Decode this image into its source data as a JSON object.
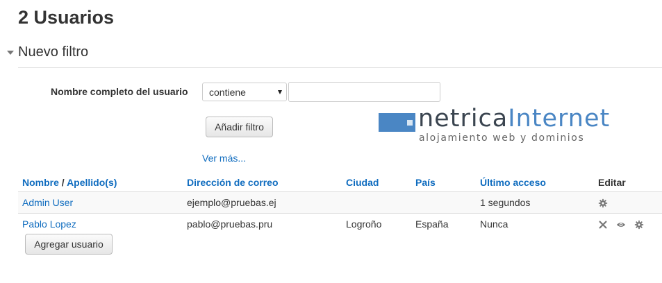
{
  "page": {
    "title": "2 Usuarios"
  },
  "filter": {
    "legend": "Nuevo filtro",
    "field_label": "Nombre completo del usuario",
    "operator": "contiene",
    "value": "",
    "add_button": "Añadir filtro",
    "more_link": "Ver más..."
  },
  "logo": {
    "word1": "netrica",
    "word2": "Internet",
    "tagline": "alojamiento web y dominios"
  },
  "table": {
    "headers": {
      "nombre": "Nombre",
      "separator": " / ",
      "apellidos": "Apellido(s)",
      "correo": "Dirección de correo",
      "ciudad": "Ciudad",
      "pais": "País",
      "acceso": "Último acceso",
      "editar": "Editar"
    },
    "rows": [
      {
        "name": "Admin User",
        "email": "ejemplo@pruebas.ej",
        "city": "",
        "country": "",
        "last_access": "1 segundos",
        "actions": [
          "gear-icon"
        ]
      },
      {
        "name": "Pablo Lopez",
        "email": "pablo@pruebas.pru",
        "city": "Logroño",
        "country": "España",
        "last_access": "Nunca",
        "actions": [
          "delete-icon",
          "eye-icon",
          "gear-icon"
        ]
      }
    ]
  },
  "add_user_button": "Agregar usuario",
  "colors": {
    "link": "#0f6cbf",
    "accent": "#4a86c4",
    "icon": "#777777"
  }
}
